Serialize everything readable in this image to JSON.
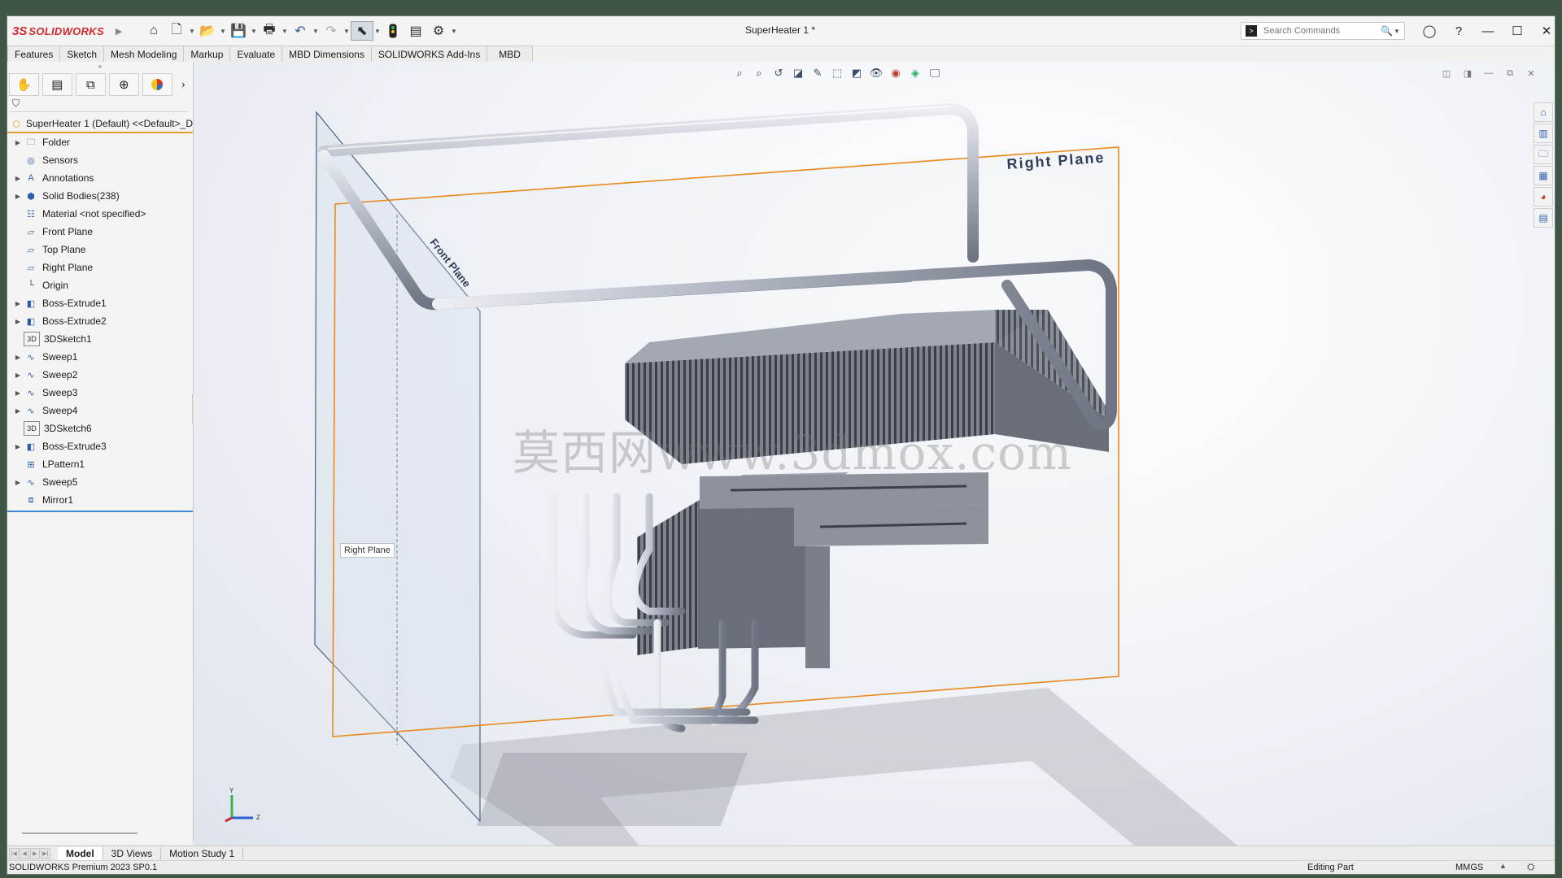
{
  "app": {
    "brand_mark": "3S",
    "brand_name": "SOLIDWORKS",
    "document_title": "SuperHeater 1 *",
    "search_placeholder": "Search Commands"
  },
  "command_tabs": [
    "Features",
    "Sketch",
    "Mesh Modeling",
    "Markup",
    "Evaluate",
    "MBD Dimensions",
    "SOLIDWORKS Add-Ins",
    "MBD"
  ],
  "feature_tree": {
    "root_label": "SuperHeater 1 (Default) <<Default>_D",
    "items": [
      {
        "label": "Folder",
        "icon": "folder-icon",
        "expandable": true
      },
      {
        "label": "Sensors",
        "icon": "sensor-icon",
        "expandable": false
      },
      {
        "label": "Annotations",
        "icon": "annotations-icon",
        "expandable": true
      },
      {
        "label": "Solid Bodies(238)",
        "icon": "solid-bodies-icon",
        "expandable": true
      },
      {
        "label": "Material <not specified>",
        "icon": "material-icon",
        "expandable": false
      },
      {
        "label": "Front Plane",
        "icon": "plane-icon",
        "expandable": false
      },
      {
        "label": "Top Plane",
        "icon": "plane-icon",
        "expandable": false
      },
      {
        "label": "Right Plane",
        "icon": "plane-icon",
        "expandable": false
      },
      {
        "label": "Origin",
        "icon": "origin-icon",
        "expandable": false
      },
      {
        "label": "Boss-Extrude1",
        "icon": "extrude-icon",
        "expandable": true
      },
      {
        "label": "Boss-Extrude2",
        "icon": "extrude-icon",
        "expandable": true
      },
      {
        "label": "3DSketch1",
        "icon": "sketch3d-icon",
        "expandable": false
      },
      {
        "label": "Sweep1",
        "icon": "sweep-icon",
        "expandable": true
      },
      {
        "label": "Sweep2",
        "icon": "sweep-icon",
        "expandable": true
      },
      {
        "label": "Sweep3",
        "icon": "sweep-icon",
        "expandable": true
      },
      {
        "label": "Sweep4",
        "icon": "sweep-icon",
        "expandable": true
      },
      {
        "label": "3DSketch6",
        "icon": "sketch3d-icon",
        "expandable": false
      },
      {
        "label": "Boss-Extrude3",
        "icon": "extrude-icon",
        "expandable": true
      },
      {
        "label": "LPattern1",
        "icon": "pattern-icon",
        "expandable": false
      },
      {
        "label": "Sweep5",
        "icon": "sweep-icon",
        "expandable": true
      },
      {
        "label": "Mirror1",
        "icon": "mirror-icon",
        "expandable": false
      }
    ]
  },
  "viewport": {
    "right_plane_label": "Right Plane",
    "front_plane_label": "Front Plane",
    "plane_tooltip": "Right Plane",
    "watermark": "莫西网www.3dmox.com",
    "triad": {
      "y": "Y",
      "z": "Z"
    },
    "colors": {
      "plane_highlight": "#e8891d",
      "front_plane_edge": "#4a5f82",
      "tube": "#9ea4b2",
      "fins": "#5a5d66"
    }
  },
  "bottom_tabs": [
    "Model",
    "3D Views",
    "Motion Study 1"
  ],
  "status": {
    "product": "SOLIDWORKS Premium 2023 SP0.1",
    "mode": "Editing Part",
    "units": "MMGS"
  }
}
